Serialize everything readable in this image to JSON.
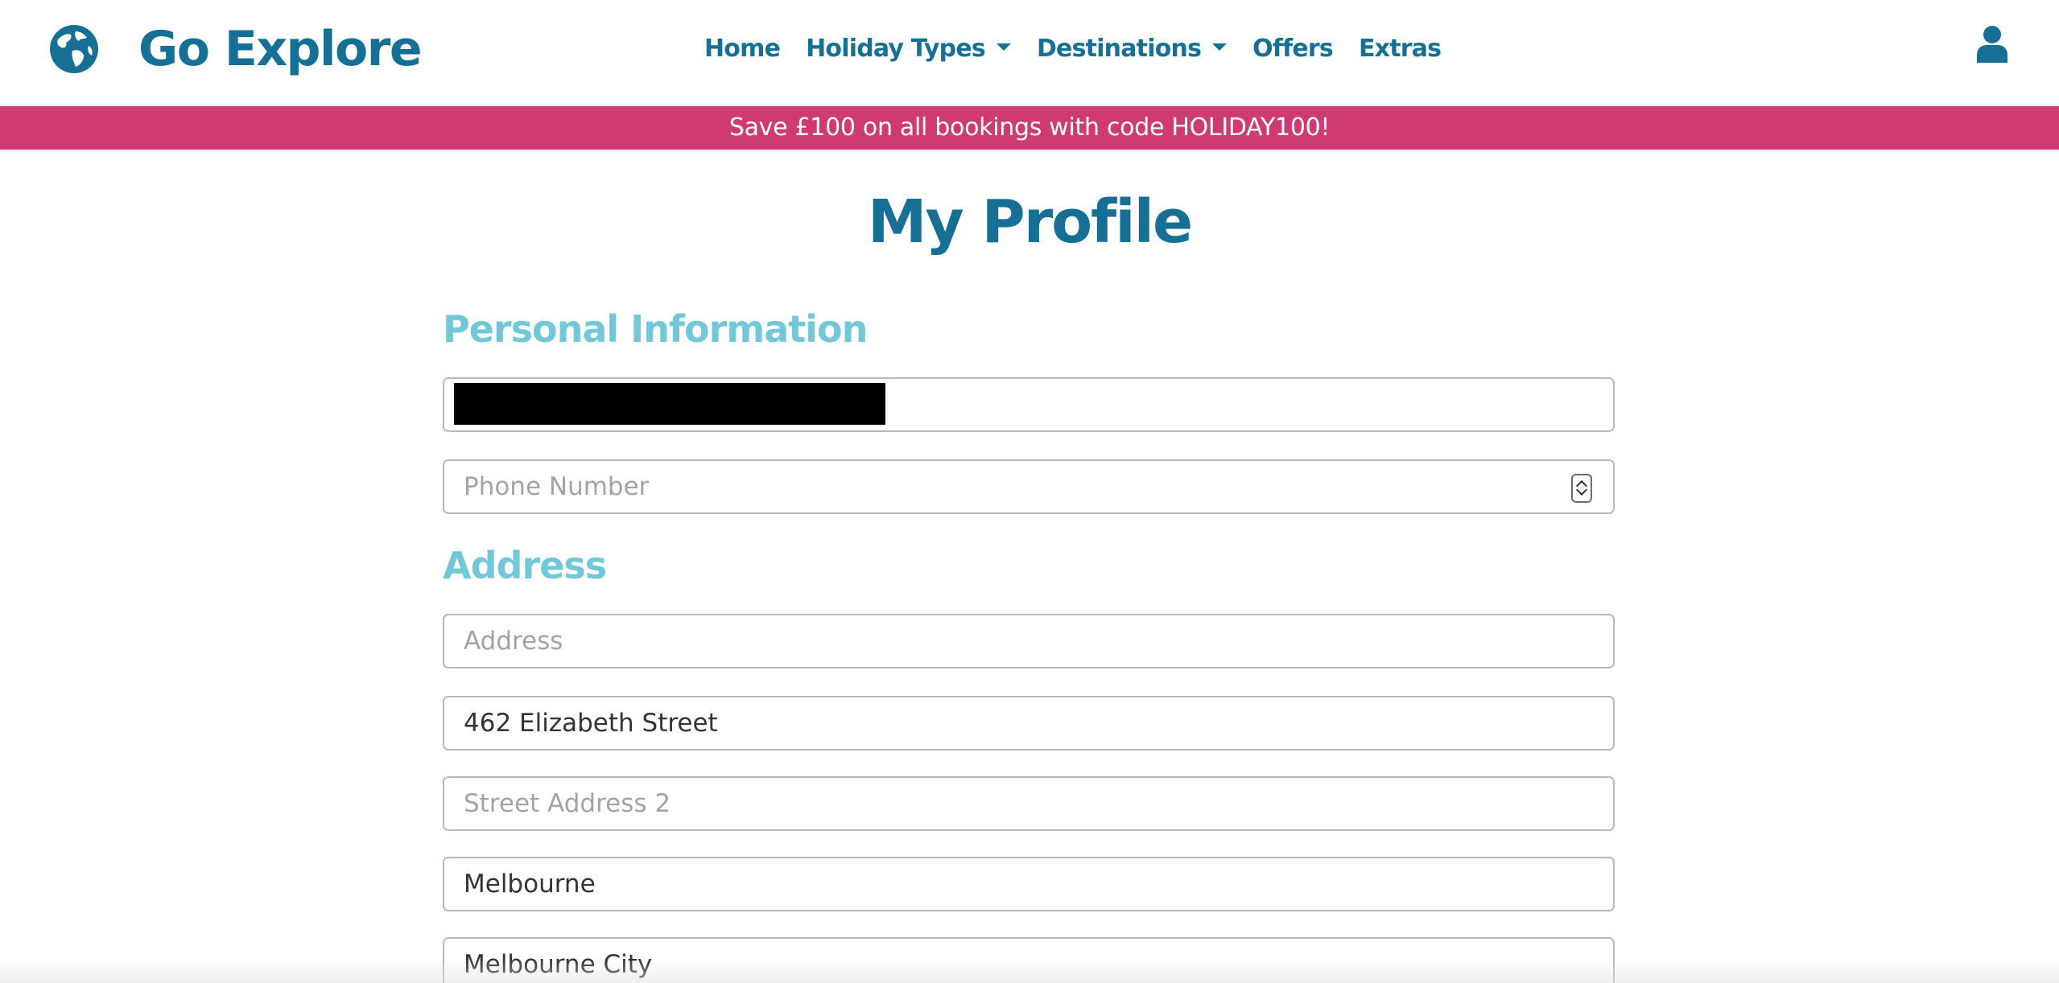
{
  "header": {
    "brand_name": "Go Explore",
    "logo_icon": "globe-icon",
    "nav": [
      {
        "label": "Home",
        "dropdown": false
      },
      {
        "label": "Holiday Types",
        "dropdown": true
      },
      {
        "label": "Destinations",
        "dropdown": true
      },
      {
        "label": "Offers",
        "dropdown": false
      },
      {
        "label": "Extras",
        "dropdown": false
      }
    ],
    "account_icon": "user-icon"
  },
  "promo_banner": {
    "text": "Save £100 on all bookings with code HOLIDAY100!"
  },
  "page": {
    "title": "My Profile",
    "personal_section": {
      "heading": "Personal Information",
      "name_field": {
        "value": "",
        "redacted": true
      },
      "phone_field": {
        "value": "",
        "placeholder": "Phone Number"
      }
    },
    "address_section": {
      "heading": "Address",
      "address_field": {
        "value": "",
        "placeholder": "Address"
      },
      "street1_field": {
        "value": "462 Elizabeth Street"
      },
      "street2_field": {
        "value": "",
        "placeholder": "Street Address 2"
      },
      "city_field": {
        "value": "Melbourne"
      },
      "region_field": {
        "value": "Melbourne City"
      }
    }
  },
  "colors": {
    "primary": "#166f94",
    "section_heading": "#72c7d9",
    "banner": "#cf3a72",
    "input_border": "#b9b9b9",
    "placeholder": "#a3a3a3"
  }
}
